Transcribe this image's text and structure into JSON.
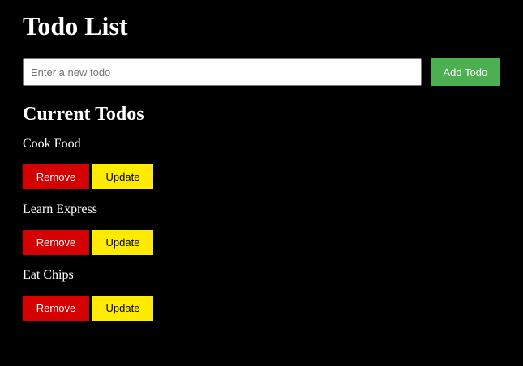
{
  "app": {
    "title": "Todo List"
  },
  "add_form": {
    "input_placeholder": "Enter a new todo",
    "input_value": "",
    "add_button_label": "Add Todo"
  },
  "todos_section": {
    "heading": "Current Todos",
    "items": [
      {
        "text": "Cook Food",
        "remove_label": "Remove",
        "update_label": "Update"
      },
      {
        "text": "Learn Express",
        "remove_label": "Remove",
        "update_label": "Update"
      },
      {
        "text": "Eat Chips",
        "remove_label": "Remove",
        "update_label": "Update"
      }
    ]
  },
  "colors": {
    "background": "#000000",
    "text": "#ffffff",
    "add_button": "#4caf50",
    "remove_button": "#d50000",
    "update_button": "#ffeb00"
  }
}
